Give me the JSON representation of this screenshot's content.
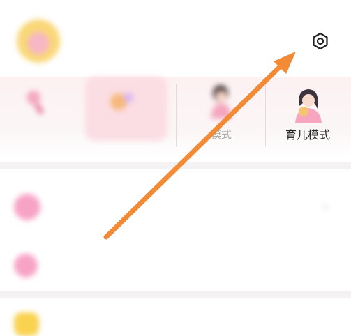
{
  "header": {
    "username": "",
    "settings_icon": "settings-hexagon-icon"
  },
  "modes": [
    {
      "label": ""
    },
    {
      "label": ""
    },
    {
      "label": "",
      "label_suffix": "模式"
    },
    {
      "label": "育儿模式"
    }
  ],
  "list": {
    "item1": {
      "title": "",
      "subtitle": ""
    },
    "item2": {
      "title": ""
    },
    "item3": {
      "title": ""
    }
  },
  "colors": {
    "accent": "#f28a36",
    "pink_icon": "#f7a3c6",
    "yellow_icon": "#f9d24f"
  }
}
